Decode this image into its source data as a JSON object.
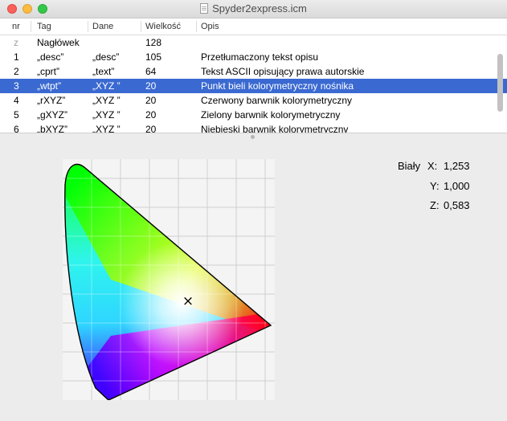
{
  "window": {
    "title": "Spyder2express.icm"
  },
  "table": {
    "headers": {
      "nr": "nr",
      "tag": "Tag",
      "data": "Dane",
      "size": "Wielkość",
      "desc": "Opis"
    },
    "rows": [
      {
        "nr": "z",
        "tag": "Nagłówek",
        "data": "",
        "size": "128",
        "desc": ""
      },
      {
        "nr": "1",
        "tag": "„desc”",
        "data": "„desc”",
        "size": "105",
        "desc": "Przetłumaczony tekst opisu"
      },
      {
        "nr": "2",
        "tag": "„cprt”",
        "data": "„text”",
        "size": "64",
        "desc": "Tekst ASCII opisujący prawa autorskie"
      },
      {
        "nr": "3",
        "tag": "„wtpt”",
        "data": "„XYZ ”",
        "size": "20",
        "desc": "Punkt bieli kolorymetryczny nośnika",
        "selected": true
      },
      {
        "nr": "4",
        "tag": "„rXYZ”",
        "data": "„XYZ ”",
        "size": "20",
        "desc": "Czerwony barwnik kolorymetryczny"
      },
      {
        "nr": "5",
        "tag": "„gXYZ”",
        "data": "„XYZ ”",
        "size": "20",
        "desc": "Zielony barwnik kolorymetryczny"
      },
      {
        "nr": "6",
        "tag": "„bXYZ”",
        "data": "„XYZ ”",
        "size": "20",
        "desc": "Niebieski barwnik kolorymetryczny"
      }
    ],
    "selected_color": "#3a69d1"
  },
  "info": {
    "title": "Biały",
    "x_label": "X:",
    "x_value": "1,253",
    "y_label": "Y:",
    "y_value": "1,000",
    "z_label": "Z:",
    "z_value": "0,583"
  },
  "diagram": {
    "white_point_marker": "×"
  }
}
